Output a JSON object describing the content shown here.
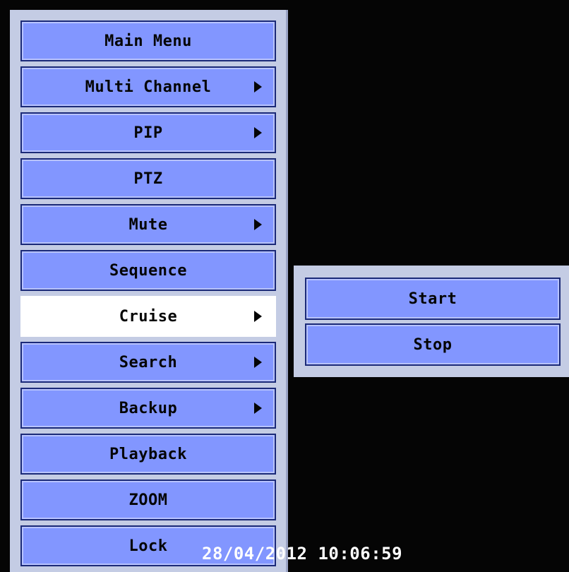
{
  "main_menu": {
    "title": "Main Menu",
    "items": [
      {
        "label": "Multi Channel",
        "has_submenu": true
      },
      {
        "label": "PIP",
        "has_submenu": true
      },
      {
        "label": "PTZ",
        "has_submenu": false
      },
      {
        "label": "Mute",
        "has_submenu": true
      },
      {
        "label": "Sequence",
        "has_submenu": false
      },
      {
        "label": "Cruise",
        "has_submenu": true,
        "selected": true
      },
      {
        "label": "Search",
        "has_submenu": true
      },
      {
        "label": "Backup",
        "has_submenu": true
      },
      {
        "label": "Playback",
        "has_submenu": false
      },
      {
        "label": "ZOOM",
        "has_submenu": false
      },
      {
        "label": "Lock",
        "has_submenu": false
      }
    ]
  },
  "cruise_submenu": {
    "items": [
      {
        "label": "Start"
      },
      {
        "label": "Stop"
      }
    ]
  },
  "status": {
    "timestamp": "28/04/2012 10:06:59"
  },
  "colors": {
    "background": "#050505",
    "panel": "#c4cce4",
    "button": "#8296ff",
    "button_border": "#1b2a78",
    "selected": "#ffffff",
    "text": "#050505",
    "timestamp": "#ffffff"
  }
}
